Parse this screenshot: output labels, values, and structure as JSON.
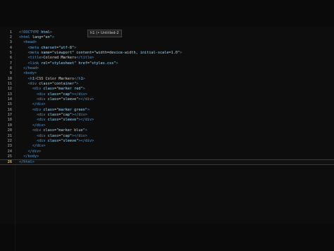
{
  "tooltip": {
    "text": "h1 (• Untitled-2"
  },
  "active_line": 26,
  "lines": [
    {
      "n": "1",
      "code": "<!DOCTYPE html>"
    },
    {
      "n": "2",
      "code": "<html lang=\"en\">"
    },
    {
      "n": "3",
      "code": "  <head>"
    },
    {
      "n": "4",
      "code": "    <meta charset=\"utf-8\">"
    },
    {
      "n": "5",
      "code": "    <meta name=\"viewport\" content=\"width=device-width, initial-scale=1.0\">"
    },
    {
      "n": "6",
      "code": "    <title>Colored Markers</title>"
    },
    {
      "n": "7",
      "code": "    <link rel=\"stylesheet\" href=\"styles.css\">"
    },
    {
      "n": "8",
      "code": "  </head>"
    },
    {
      "n": "9",
      "code": "  <body>"
    },
    {
      "n": "10",
      "code": "    <h1>CSS Color Markers</h1>"
    },
    {
      "n": "11",
      "code": "    <div class=\"container\">"
    },
    {
      "n": "12",
      "code": "      <div class=\"marker red\">"
    },
    {
      "n": "13",
      "code": "        <div class=\"cap\"></div>"
    },
    {
      "n": "14",
      "code": "        <div class=\"sleeve\"></div>"
    },
    {
      "n": "15",
      "code": "      </div>"
    },
    {
      "n": "16",
      "code": "      <div class=\"marker green\">"
    },
    {
      "n": "17",
      "code": "        <div class=\"cap\"></div>"
    },
    {
      "n": "18",
      "code": "        <div class=\"sleeve\"></div>"
    },
    {
      "n": "19",
      "code": "      </div>"
    },
    {
      "n": "20",
      "code": "      <div class=\"marker blue\">"
    },
    {
      "n": "21",
      "code": "        <div class=\"cap\"></div>"
    },
    {
      "n": "22",
      "code": "        <div class=\"sleeve\"></div>"
    },
    {
      "n": "23",
      "code": "      </div>"
    },
    {
      "n": "24",
      "code": "    </div>"
    },
    {
      "n": "25",
      "code": "  </body>"
    },
    {
      "n": "26",
      "code": "</html>"
    }
  ],
  "colors": {
    "background": "#0a0a0a",
    "tag": "#569cd6",
    "attribute": "#9cdcfe",
    "string": "#ce9178",
    "text": "#d4d4d4",
    "line_number": "#8a8a8a",
    "active_line_number": "#e8c060"
  }
}
